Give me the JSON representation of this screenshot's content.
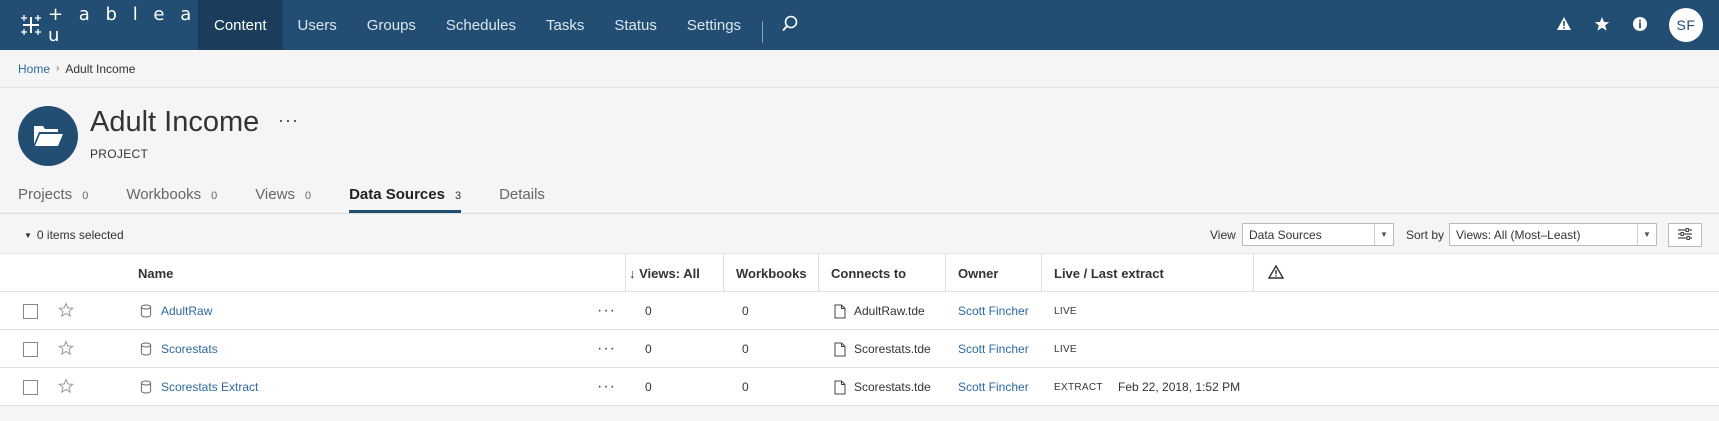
{
  "brand": {
    "logo_text": "+ a b l e a u"
  },
  "nav": {
    "items": [
      "Content",
      "Users",
      "Groups",
      "Schedules",
      "Tasks",
      "Status",
      "Settings"
    ],
    "active": "Content"
  },
  "top_right": {
    "avatar_initials": "SF"
  },
  "breadcrumb": {
    "home": "Home",
    "current": "Adult Income"
  },
  "project": {
    "title": "Adult Income",
    "type": "PROJECT",
    "more": "···"
  },
  "tabs": [
    {
      "label": "Projects",
      "count": "0"
    },
    {
      "label": "Workbooks",
      "count": "0"
    },
    {
      "label": "Views",
      "count": "0"
    },
    {
      "label": "Data Sources",
      "count": "3"
    },
    {
      "label": "Details",
      "count": ""
    }
  ],
  "active_tab": "Data Sources",
  "toolbar": {
    "selected": "0 items selected",
    "view_label": "View",
    "view_value": "Data Sources",
    "sort_label": "Sort by",
    "sort_value": "Views: All (Most–Least)"
  },
  "columns": {
    "name": "Name",
    "views": "↓ Views: All",
    "workbooks": "Workbooks",
    "connects": "Connects to",
    "owner": "Owner",
    "live": "Live / Last extract"
  },
  "rows": [
    {
      "name": "AdultRaw",
      "views": "0",
      "workbooks": "0",
      "connects": "AdultRaw.tde",
      "owner": "Scott Fincher",
      "type": "LIVE",
      "last_extract": ""
    },
    {
      "name": "Scorestats",
      "views": "0",
      "workbooks": "0",
      "connects": "Scorestats.tde",
      "owner": "Scott Fincher",
      "type": "LIVE",
      "last_extract": ""
    },
    {
      "name": "Scorestats Extract",
      "views": "0",
      "workbooks": "0",
      "connects": "Scorestats.tde",
      "owner": "Scott Fincher",
      "type": "EXTRACT",
      "last_extract": "Feb 22, 2018, 1:52 PM"
    }
  ],
  "row_more": "···",
  "colors": {
    "nav_bg": "#234e74",
    "nav_active": "#1a3d5c",
    "link": "#2c6aa0"
  },
  "icons": [
    "tableau-logo-icon",
    "search-icon",
    "alert-icon",
    "star-icon",
    "info-icon",
    "folder-icon",
    "caret-down-icon",
    "filter-settings-icon",
    "warning-icon",
    "database-icon",
    "file-icon"
  ]
}
